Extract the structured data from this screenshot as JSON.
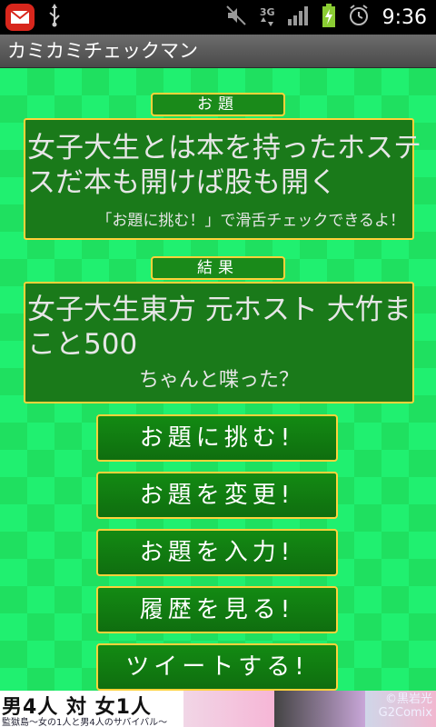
{
  "status_bar": {
    "time": "9:36",
    "icons": [
      "mail-icon",
      "usb-icon",
      "mute-icon",
      "3g-icon",
      "signal-icon",
      "battery-charging-icon",
      "alarm-icon"
    ],
    "network_label": "3G"
  },
  "app": {
    "title": "カミカミチェックマン"
  },
  "topic": {
    "label": "お題",
    "text": "女子大生とは本を持ったホステスだ本も開けば股も開く",
    "hint": "「お題に挑む！」で滑舌チェックできるよ！"
  },
  "result": {
    "label": "結果",
    "text": "女子大生東方 元ホスト 大竹まこと500",
    "question": "ちゃんと喋った？"
  },
  "buttons": {
    "challenge": "お題に挑む!",
    "change": "お題を変更!",
    "input": "お題を入力!",
    "history": "履歴を見る!",
    "tweet": "ツイートする!"
  },
  "ad": {
    "headline": "男4人 対 女1人",
    "subline": "監獄島〜女の1人と男4人のサバイバル〜",
    "credit_line1": "©黒岩光",
    "credit_line2": "G2Comix"
  },
  "colors": {
    "background_green": "#20f070",
    "panel_green": "#1a7a1a",
    "border_yellow": "#ffd23a",
    "titlebar_gray": "#5a5a5a"
  }
}
